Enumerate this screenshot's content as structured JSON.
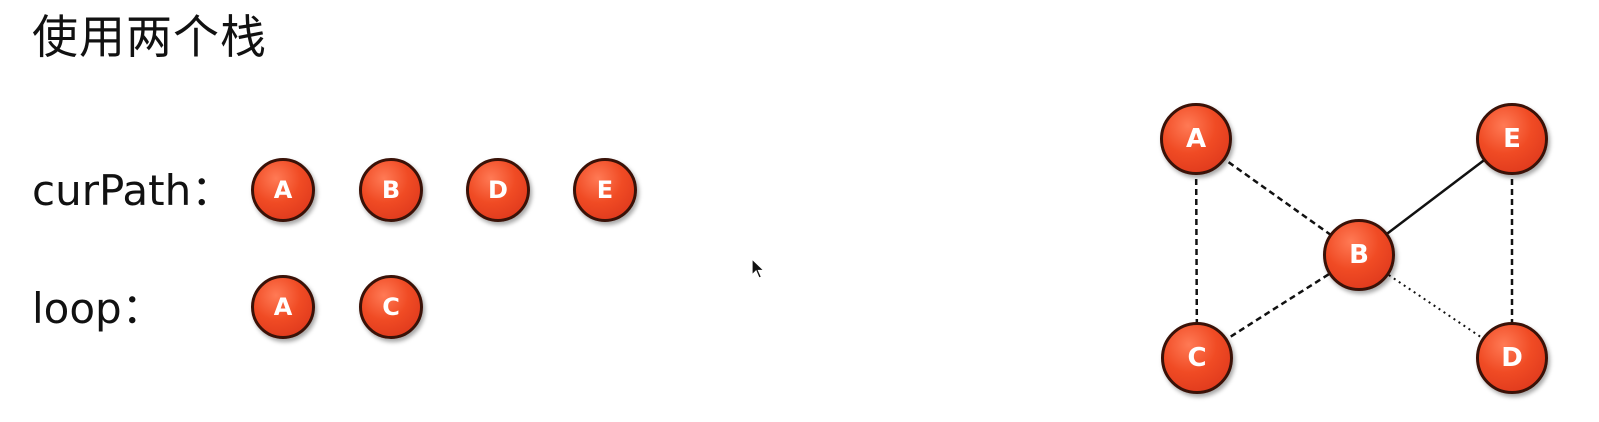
{
  "title": "使用两个栈",
  "stacks": {
    "curpath": {
      "label": "curPath：",
      "items": [
        "A",
        "B",
        "D",
        "E"
      ]
    },
    "loop": {
      "label": "loop：",
      "items": [
        "A",
        "C"
      ]
    }
  },
  "graph": {
    "nodes": [
      "A",
      "E",
      "B",
      "C",
      "D"
    ],
    "edges": [
      {
        "from": "A",
        "to": "C",
        "style": "dashed"
      },
      {
        "from": "A",
        "to": "B",
        "style": "dashed"
      },
      {
        "from": "C",
        "to": "B",
        "style": "dashed"
      },
      {
        "from": "B",
        "to": "E",
        "style": "solid"
      },
      {
        "from": "B",
        "to": "D",
        "style": "dotted"
      },
      {
        "from": "E",
        "to": "D",
        "style": "dashed"
      }
    ]
  },
  "colors": {
    "node_fill": "#f04b24",
    "node_border": "#3a1208",
    "node_text": "#ffffff",
    "edge": "#111111"
  },
  "icons": {
    "cursor": "mouse-pointer-icon"
  }
}
